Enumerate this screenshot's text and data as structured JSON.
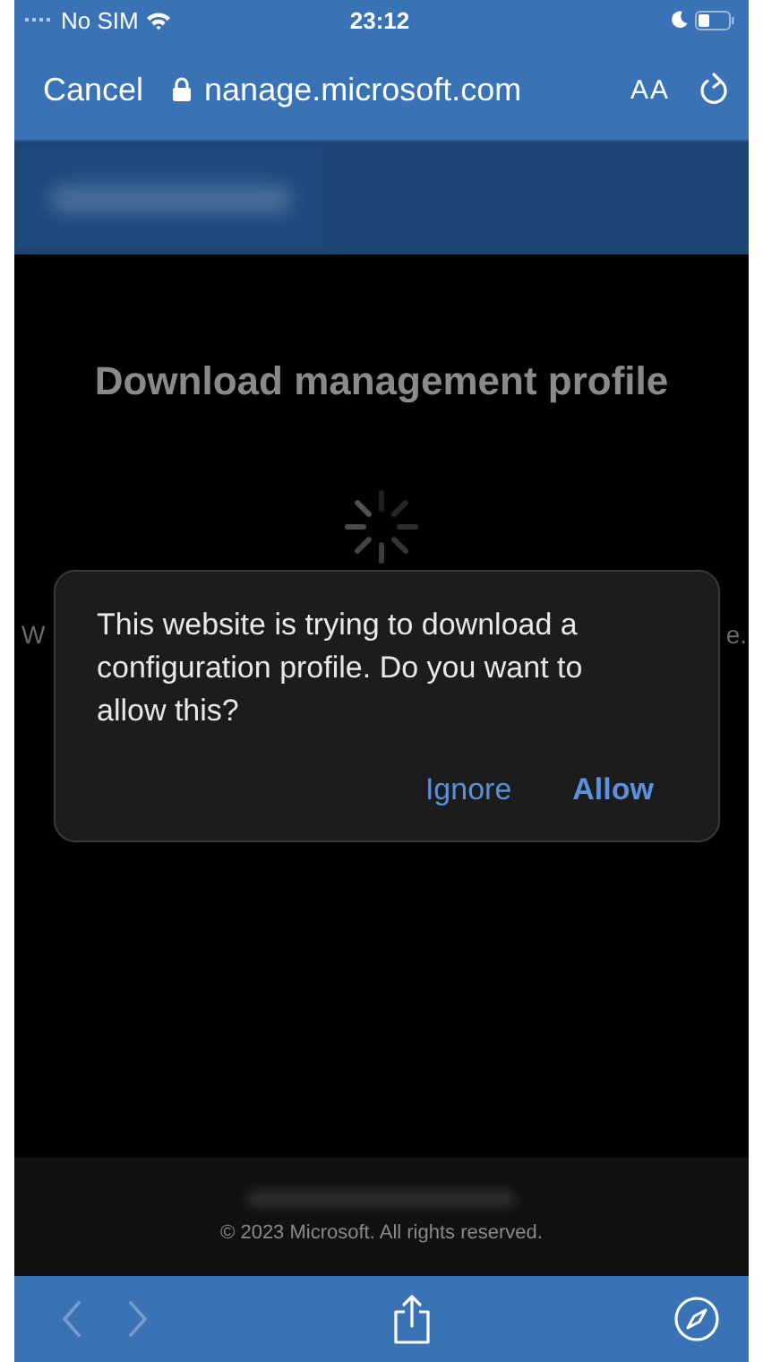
{
  "status_bar": {
    "carrier": "No SIM",
    "time": "23:12"
  },
  "address_bar": {
    "cancel": "Cancel",
    "url": "nanage.microsoft.com",
    "text_size": "AA"
  },
  "page": {
    "title": "Download management profile",
    "text_fragments": [
      "W",
      "e."
    ],
    "loading": true,
    "footer": "© 2023 Microsoft. All rights reserved."
  },
  "dialog": {
    "message": "This website is trying to download a configuration profile. Do you want to allow this?",
    "buttons": [
      {
        "label": "Ignore",
        "kind": "secondary"
      },
      {
        "label": "Allow",
        "kind": "primary"
      }
    ]
  },
  "toolbar": {
    "back_disabled": true,
    "forward_disabled": true
  }
}
